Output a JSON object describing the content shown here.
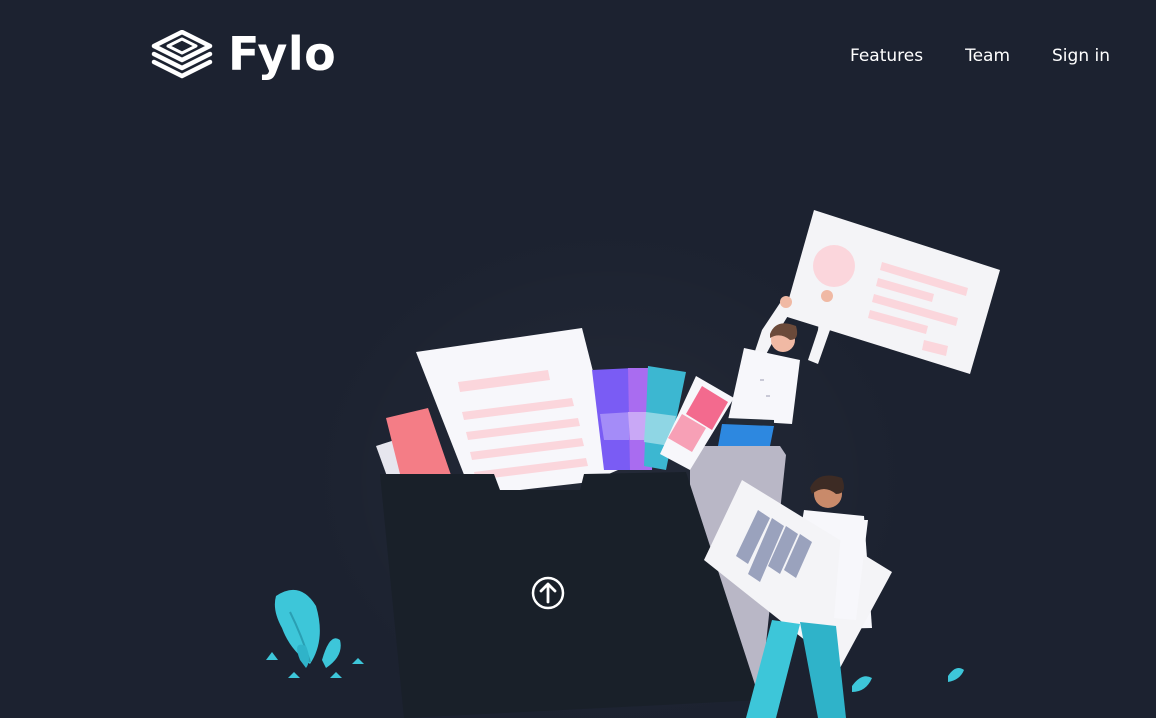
{
  "brand": {
    "name": "Fylo",
    "logo_icon": "stacked-layers-icon"
  },
  "nav": {
    "items": [
      {
        "label": "Features"
      },
      {
        "label": "Team"
      },
      {
        "label": "Sign in"
      }
    ]
  },
  "hero": {
    "upload_icon": "upload-arrow-icon"
  },
  "colors": {
    "background": "#1c2230",
    "folder": "#192029",
    "accent_cyan": "#3dc6d9",
    "accent_pink": "#f77a8c"
  }
}
